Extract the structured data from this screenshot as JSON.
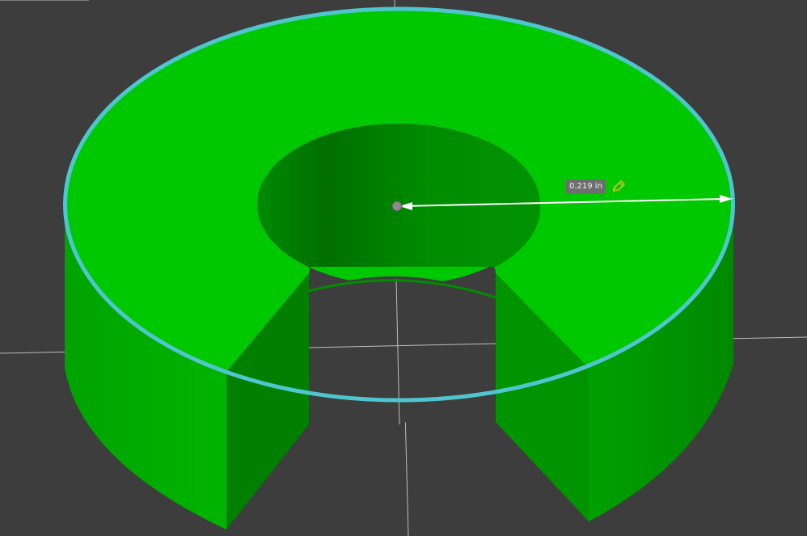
{
  "viewport": {
    "background_color": "#3d3d3d",
    "grid_color": "#bdbdbd"
  },
  "model": {
    "top_face_color": "#00c800",
    "side_face_color": "#009700",
    "inner_wall_color": "#007a00",
    "selected_edge_color": "#4fc6cf"
  },
  "measurement": {
    "label": "0.219 in",
    "arrow_color": "#ffffff",
    "edit_icon": "pencil-edit-icon",
    "edit_icon_color": "#b8c31a"
  }
}
